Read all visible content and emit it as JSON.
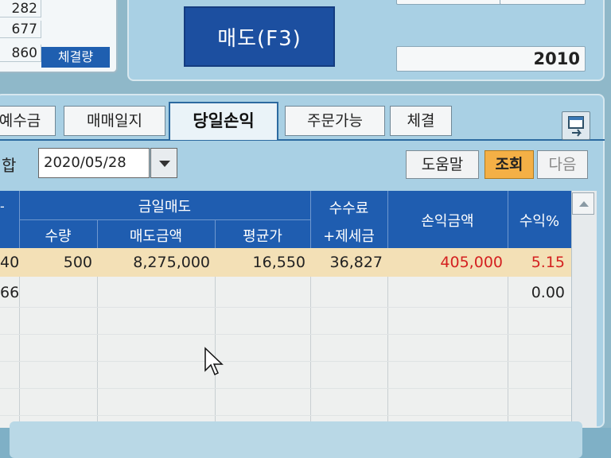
{
  "top_left": {
    "qty_values": [
      "282",
      "677",
      "860"
    ],
    "exec_qty_label": "체결량"
  },
  "sell_button": {
    "label": "매도(F3)"
  },
  "top_right": {
    "value": "2010"
  },
  "tabs": [
    {
      "label": "예수금"
    },
    {
      "label": "매매일지"
    },
    {
      "label": "당일손익"
    },
    {
      "label": "주문가능"
    },
    {
      "label": "체결"
    }
  ],
  "filter": {
    "left_label": "합",
    "date": "2020/05/28",
    "help_label": "도움말",
    "query_label": "조회",
    "next_label": "다음"
  },
  "grid": {
    "group_today_sell": "금일매도",
    "col_qty": "수량",
    "col_sell_amount": "매도금액",
    "col_avg_price": "평균가",
    "col_fee_line1": "수수료",
    "col_fee_line2": "+제세금",
    "col_pl_amount": "손익금액",
    "col_return": "수익%",
    "row1": {
      "partial_left": "40",
      "qty": "500",
      "sell_amount": "8,275,000",
      "avg_price": "16,550",
      "fee_tax": "36,827",
      "pl_amount": "405,000",
      "return_pct": "5.15"
    },
    "row2": {
      "partial_left": "66",
      "return_pct": "0.00"
    }
  },
  "colors": {
    "header_blue": "#1f5db0",
    "row_highlight": "#f3e0b6",
    "profit_red": "#d42020",
    "query_button": "#f4b046"
  }
}
